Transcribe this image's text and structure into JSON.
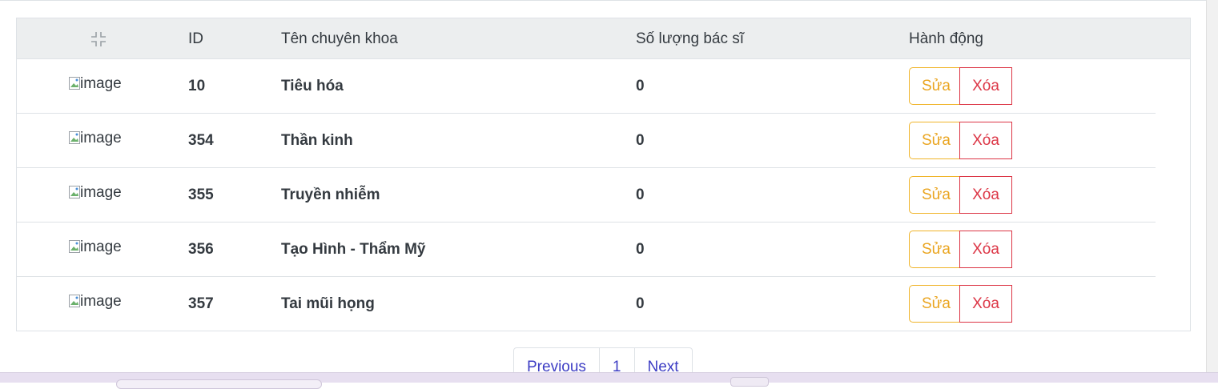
{
  "table": {
    "headers": {
      "id": "ID",
      "name": "Tên chuyên khoa",
      "doctors": "Số lượng bác sĩ",
      "actions": "Hành động"
    },
    "image_alt": "image",
    "rows": [
      {
        "id": "10",
        "name": "Tiêu hóa",
        "doctors": "0"
      },
      {
        "id": "354",
        "name": "Thần kinh",
        "doctors": "0"
      },
      {
        "id": "355",
        "name": "Truyền nhiễm",
        "doctors": "0"
      },
      {
        "id": "356",
        "name": "Tạo Hình - Thẩm Mỹ",
        "doctors": "0"
      },
      {
        "id": "357",
        "name": "Tai mũi họng",
        "doctors": "0"
      }
    ],
    "edit_label": "Sửa",
    "delete_label": "Xóa"
  },
  "pagination": {
    "previous": "Previous",
    "page": "1",
    "next": "Next"
  },
  "colors": {
    "header_bg": "#eceeef",
    "edit": "#eaa520",
    "delete": "#dc3545",
    "link": "#3d3dc4"
  }
}
